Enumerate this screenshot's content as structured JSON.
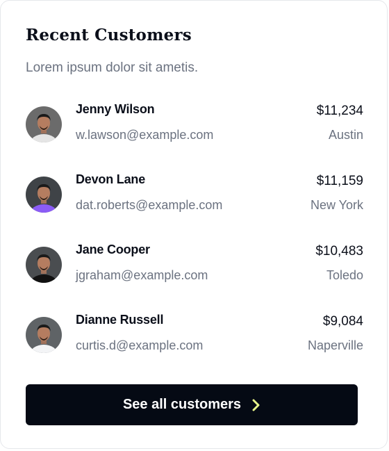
{
  "card": {
    "title": "Recent Customers",
    "subtitle": "Lorem ipsum dolor sit ametis."
  },
  "customers": [
    {
      "name": "Jenny Wilson",
      "email": "w.lawson@example.com",
      "amount": "$11,234",
      "city": "Austin",
      "avatar_shirt": "#e5e5e5",
      "avatar_bg": "#6b6b6b"
    },
    {
      "name": "Devon Lane",
      "email": "dat.roberts@example.com",
      "amount": "$11,159",
      "city": "New York",
      "avatar_shirt": "#8b5cf6",
      "avatar_bg": "#3f4347"
    },
    {
      "name": "Jane Cooper",
      "email": "jgraham@example.com",
      "amount": "$10,483",
      "city": "Toledo",
      "avatar_shirt": "#111111",
      "avatar_bg": "#4a4d50"
    },
    {
      "name": "Dianne Russell",
      "email": "curtis.d@example.com",
      "amount": "$9,084",
      "city": "Naperville",
      "avatar_shirt": "#f3f4f6",
      "avatar_bg": "#5f6366"
    }
  ],
  "cta": {
    "label": "See all customers",
    "icon": "chevron-right-icon",
    "icon_color": "#e8f58a",
    "background": "#050a14"
  }
}
